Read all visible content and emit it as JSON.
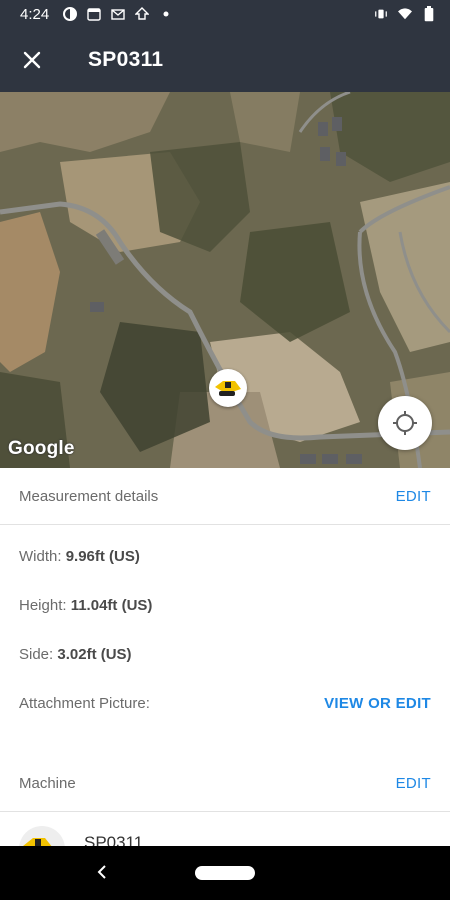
{
  "status_bar": {
    "time": "4:24",
    "left_icons": [
      "circle-half-icon",
      "calendar-icon",
      "gmail-icon",
      "upload-icon",
      "dot-icon"
    ],
    "calendar_day": "31",
    "right_icons": [
      "vibrate-icon",
      "wifi-icon",
      "battery-icon"
    ]
  },
  "app_bar": {
    "title": "SP0311"
  },
  "map": {
    "provider_logo": "Google"
  },
  "measurement": {
    "section_label": "Measurement details",
    "edit_label": "EDIT",
    "width_label": "Width:",
    "width_value": "9.96ft (US)",
    "height_label": "Height:",
    "height_value": "11.04ft (US)",
    "side_label": "Side:",
    "side_value": "3.02ft (US)",
    "attachment_label": "Attachment Picture:",
    "attachment_action": "VIEW OR EDIT"
  },
  "machine": {
    "section_label": "Machine",
    "edit_label": "EDIT",
    "name": "SP0311"
  },
  "colors": {
    "app_bar": "#2f3540",
    "accent": "#1e88e5",
    "machine_yellow": "#f2c200"
  }
}
